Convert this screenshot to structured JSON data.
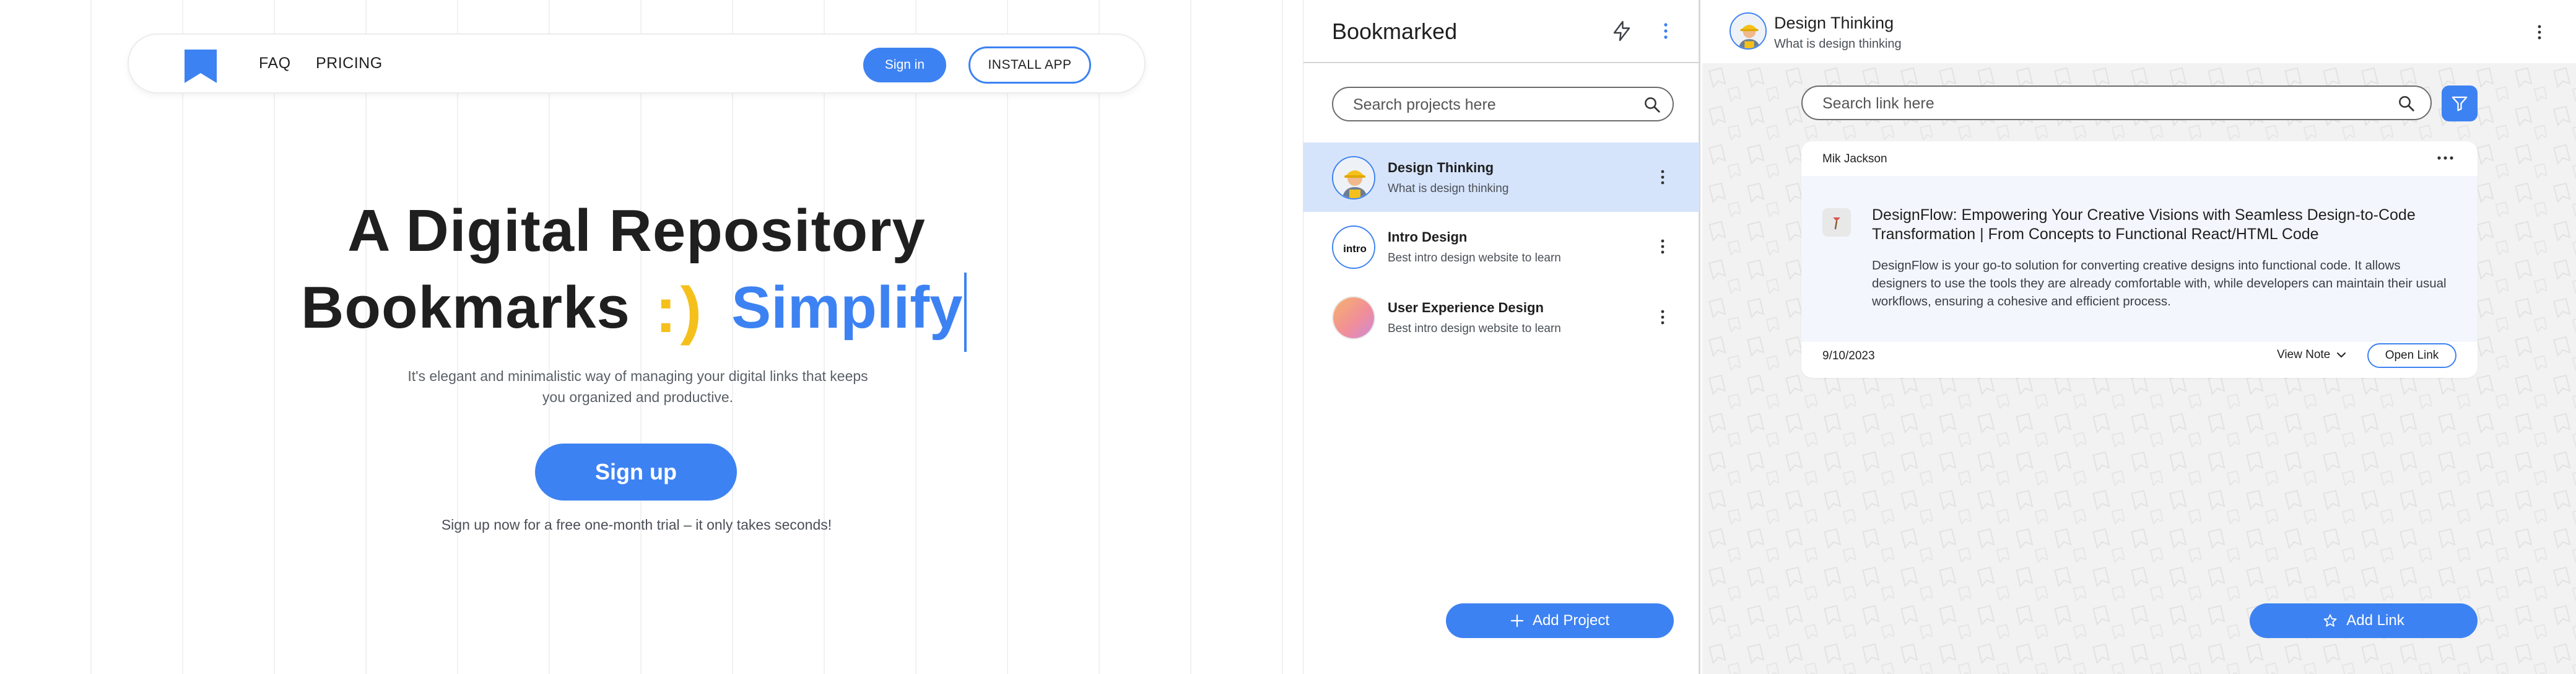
{
  "landing": {
    "nav": {
      "faq": "FAQ",
      "pricing": "PRICING",
      "sign_in": "Sign in",
      "install": "INSTALL APP"
    },
    "hero": {
      "line1": "A Digital Repository",
      "word1": "Bookmarks",
      "smiley": ":)",
      "word2": "Simplify",
      "description": "It's elegant and minimalistic way of managing your digital links that keeps you organized and productive.",
      "signup": "Sign up",
      "note": "Sign up now for a free one-month trial – it only takes seconds!"
    },
    "colors": {
      "accent": "#3d82f2",
      "smiley": "#f5c01b"
    }
  },
  "projects": {
    "title": "Bookmarked",
    "search_placeholder": "Search projects here",
    "items": [
      {
        "name": "Design Thinking",
        "subtitle": "What is design thinking",
        "active": true,
        "avatar": "worker-avatar"
      },
      {
        "name": "Intro Design",
        "subtitle": "Best intro design website to learn",
        "active": false,
        "avatar": "intro-logo",
        "logo_text": "intro"
      },
      {
        "name": "User Experience Design",
        "subtitle": "Best intro design website to learn",
        "active": false,
        "avatar": "gradient-avatar"
      }
    ],
    "add_button": "Add Project"
  },
  "links": {
    "project_title": "Design Thinking",
    "project_subtitle": "What is design thinking",
    "search_placeholder": "Search link here",
    "card": {
      "author": "Mik Jackson",
      "title": "DesignFlow: Empowering Your Creative Visions with Seamless Design-to-Code Transformation | From Concepts to Functional React/HTML Code",
      "description": "DesignFlow is your go-to solution for converting creative designs into functional code. It allows designers to use the tools they are already comfortable with, while developers can maintain their usual workflows, ensuring a cohesive and efficient process.",
      "date": "9/10/2023",
      "view_note": "View Note",
      "open_link": "Open Link"
    },
    "add_button": "Add Link"
  }
}
